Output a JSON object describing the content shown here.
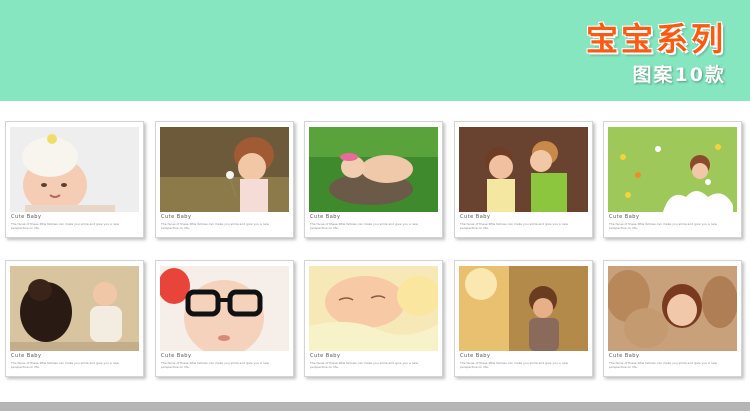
{
  "header": {
    "title": "宝宝系列",
    "subtitle": "图案10款",
    "background_color": "#85e6c0",
    "title_color": "#ff5a12"
  },
  "cards": [
    {
      "caption_title": "Cute Baby",
      "caption_text": "The faces of these little fellows can make you smile and give you a new perspective on life.",
      "photo": "baby-in-knit-hat-photo"
    },
    {
      "caption_title": "Cute Baby",
      "caption_text": "The faces of these little fellows can make you smile and give you a new perspective on life.",
      "photo": "curly-girl-blowing-dandelion-photo"
    },
    {
      "caption_title": "Cute Baby",
      "caption_text": "The faces of these little fellows can make you smile and give you a new perspective on life.",
      "photo": "sleeping-baby-on-grass-photo"
    },
    {
      "caption_title": "Cute Baby",
      "caption_text": "The faces of these little fellows can make you smile and give you a new perspective on life.",
      "photo": "boy-kissing-girl-photo"
    },
    {
      "caption_title": "Cute Baby",
      "caption_text": "The faces of these little fellows can make you smile and give you a new perspective on life.",
      "photo": "child-in-flower-meadow-photo"
    },
    {
      "caption_title": "Cute Baby",
      "caption_text": "The faces of these little fellows can make you smile and give you a new perspective on life.",
      "photo": "baby-with-dog-photo"
    },
    {
      "caption_title": "Cute Baby",
      "caption_text": "The faces of these little fellows can make you smile and give you a new perspective on life.",
      "photo": "baby-with-glasses-photo"
    },
    {
      "caption_title": "Cute Baby",
      "caption_text": "The faces of these little fellows can make you smile and give you a new perspective on life.",
      "photo": "sleeping-baby-yellow-blanket-photo"
    },
    {
      "caption_title": "Cute Baby",
      "caption_text": "The faces of these little fellows can make you smile and give you a new perspective on life.",
      "photo": "toddler-in-sunlight-photo"
    },
    {
      "caption_title": "Cute Baby",
      "caption_text": "The faces of these little fellows can make you smile and give you a new perspective on life.",
      "photo": "girl-with-teddy-bears-photo"
    }
  ]
}
